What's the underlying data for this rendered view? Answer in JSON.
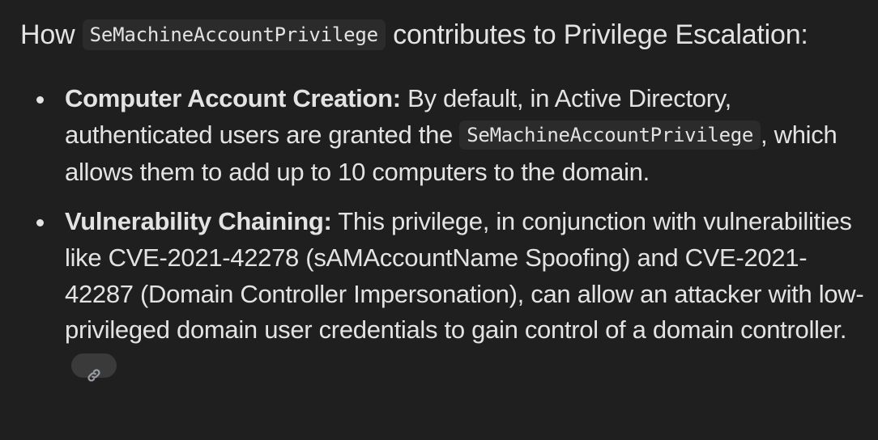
{
  "heading": {
    "prefix": "How",
    "code": "SeMachineAccountPrivilege",
    "suffix": "contributes to Privilege Escalation:"
  },
  "points": [
    {
      "label": "Computer Account Creation:",
      "text_before_code": "By default, in Active Directory, authenticated users are granted the",
      "code": "SeMachineAccountPrivilege",
      "text_after_code": ", which allows them to add up to 10 computers to the domain."
    },
    {
      "label": "Vulnerability Chaining:",
      "text": "This privilege, in conjunction with vulnerabilities like CVE-2021-42278 (sAMAccountName Spoofing) and CVE-2021-42287 (Domain Controller Impersonation), can allow an attacker with low-privileged domain user credentials to gain control of a domain controller."
    }
  ],
  "source_chip": {
    "icon": "link-icon"
  },
  "colors": {
    "background": "#1f1f1f",
    "text": "#e3e3e3",
    "code_background": "#2b2b2b",
    "chip_background": "#3a3a3a"
  }
}
